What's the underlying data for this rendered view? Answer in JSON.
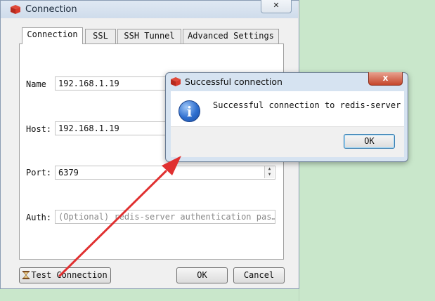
{
  "window": {
    "title": "Connection",
    "close_glyph": "✕"
  },
  "tabs": [
    {
      "label": "Connection",
      "active": true
    },
    {
      "label": "SSL"
    },
    {
      "label": "SSH Tunnel"
    },
    {
      "label": "Advanced Settings"
    }
  ],
  "form": {
    "name_label": "Name",
    "name_value": "192.168.1.19",
    "host_label": "Host:",
    "host_value": "192.168.1.19",
    "port_label": "Port:",
    "port_value": "6379",
    "auth_label": "Auth:",
    "auth_placeholder": "(Optional) redis-server authentication pas…"
  },
  "buttons": {
    "test": "Test Connection",
    "ok": "OK",
    "cancel": "Cancel"
  },
  "dialog": {
    "title": "Successful connection",
    "message": "Successful connection to redis-server",
    "ok": "OK",
    "close_glyph": "x"
  },
  "colors": {
    "accent_arrow": "#e03030",
    "desktop": "#c9e7cb"
  },
  "icons": {
    "app": "redis-logo-icon",
    "info": "info-icon",
    "test": "hourglass-icon"
  }
}
